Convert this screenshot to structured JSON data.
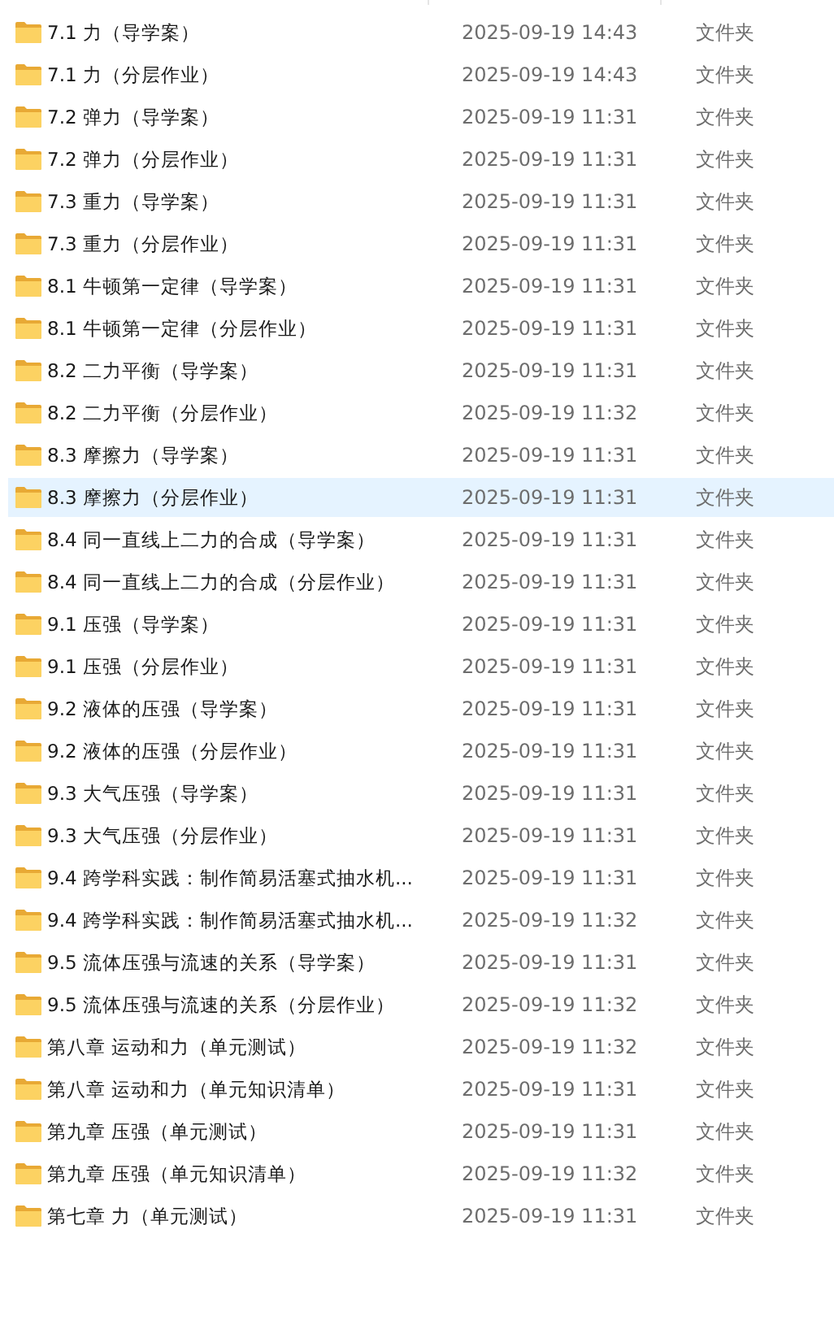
{
  "files": [
    {
      "name": "7.1 力（导学案）",
      "modified": "2025-09-19 14:43",
      "type": "文件夹",
      "selected": false
    },
    {
      "name": "7.1 力（分层作业）",
      "modified": "2025-09-19 14:43",
      "type": "文件夹",
      "selected": false
    },
    {
      "name": "7.2 弹力（导学案）",
      "modified": "2025-09-19 11:31",
      "type": "文件夹",
      "selected": false
    },
    {
      "name": "7.2 弹力（分层作业）",
      "modified": "2025-09-19 11:31",
      "type": "文件夹",
      "selected": false
    },
    {
      "name": "7.3 重力（导学案）",
      "modified": "2025-09-19 11:31",
      "type": "文件夹",
      "selected": false
    },
    {
      "name": "7.3 重力（分层作业）",
      "modified": "2025-09-19 11:31",
      "type": "文件夹",
      "selected": false
    },
    {
      "name": "8.1 牛顿第一定律（导学案）",
      "modified": "2025-09-19 11:31",
      "type": "文件夹",
      "selected": false
    },
    {
      "name": "8.1 牛顿第一定律（分层作业）",
      "modified": "2025-09-19 11:31",
      "type": "文件夹",
      "selected": false
    },
    {
      "name": "8.2 二力平衡（导学案）",
      "modified": "2025-09-19 11:31",
      "type": "文件夹",
      "selected": false
    },
    {
      "name": "8.2 二力平衡（分层作业）",
      "modified": "2025-09-19 11:32",
      "type": "文件夹",
      "selected": false
    },
    {
      "name": "8.3 摩擦力（导学案）",
      "modified": "2025-09-19 11:31",
      "type": "文件夹",
      "selected": false
    },
    {
      "name": "8.3 摩擦力（分层作业）",
      "modified": "2025-09-19 11:31",
      "type": "文件夹",
      "selected": true
    },
    {
      "name": "8.4 同一直线上二力的合成（导学案）",
      "modified": "2025-09-19 11:31",
      "type": "文件夹",
      "selected": false
    },
    {
      "name": "8.4 同一直线上二力的合成（分层作业）",
      "modified": "2025-09-19 11:31",
      "type": "文件夹",
      "selected": false
    },
    {
      "name": "9.1 压强（导学案）",
      "modified": "2025-09-19 11:31",
      "type": "文件夹",
      "selected": false
    },
    {
      "name": "9.1 压强（分层作业）",
      "modified": "2025-09-19 11:31",
      "type": "文件夹",
      "selected": false
    },
    {
      "name": "9.2 液体的压强（导学案）",
      "modified": "2025-09-19 11:31",
      "type": "文件夹",
      "selected": false
    },
    {
      "name": "9.2 液体的压强（分层作业）",
      "modified": "2025-09-19 11:31",
      "type": "文件夹",
      "selected": false
    },
    {
      "name": "9.3 大气压强（导学案）",
      "modified": "2025-09-19 11:31",
      "type": "文件夹",
      "selected": false
    },
    {
      "name": "9.3 大气压强（分层作业）",
      "modified": "2025-09-19 11:31",
      "type": "文件夹",
      "selected": false
    },
    {
      "name": "9.4 跨学科实践：制作简易活塞式抽水机...",
      "modified": "2025-09-19 11:31",
      "type": "文件夹",
      "selected": false
    },
    {
      "name": "9.4 跨学科实践：制作简易活塞式抽水机...",
      "modified": "2025-09-19 11:32",
      "type": "文件夹",
      "selected": false
    },
    {
      "name": "9.5 流体压强与流速的关系（导学案）",
      "modified": "2025-09-19 11:31",
      "type": "文件夹",
      "selected": false
    },
    {
      "name": "9.5 流体压强与流速的关系（分层作业）",
      "modified": "2025-09-19 11:32",
      "type": "文件夹",
      "selected": false
    },
    {
      "name": "第八章 运动和力（单元测试）",
      "modified": "2025-09-19 11:32",
      "type": "文件夹",
      "selected": false
    },
    {
      "name": "第八章 运动和力（单元知识清单）",
      "modified": "2025-09-19 11:31",
      "type": "文件夹",
      "selected": false
    },
    {
      "name": "第九章 压强（单元测试）",
      "modified": "2025-09-19 11:31",
      "type": "文件夹",
      "selected": false
    },
    {
      "name": "第九章 压强（单元知识清单）",
      "modified": "2025-09-19 11:32",
      "type": "文件夹",
      "selected": false
    },
    {
      "name": "第七章 力（单元测试）",
      "modified": "2025-09-19 11:31",
      "type": "文件夹",
      "selected": false
    }
  ]
}
